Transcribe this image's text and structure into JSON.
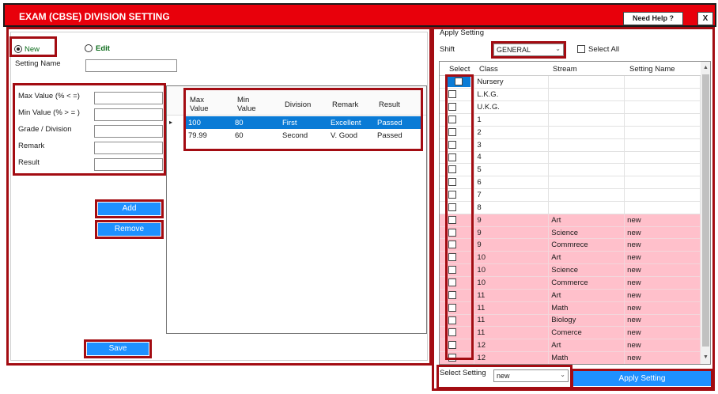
{
  "window": {
    "title": "EXAM (CBSE) DIVISION SETTING",
    "help_label": "Need Help ?",
    "close_label": "X"
  },
  "mode": {
    "new_label": "New",
    "edit_label": "Edit",
    "selected": "new"
  },
  "form": {
    "setting_name_label": "Setting Name",
    "max_value_label": "Max Value  (% < =)",
    "min_value_label": "Min Value   (% > = )",
    "grade_label": "Grade / Division",
    "remark_label": "Remark",
    "result_label": "Result"
  },
  "buttons": {
    "add": "Add",
    "remove": "Remove",
    "save": "Save",
    "apply": "Apply Setting"
  },
  "division_grid": {
    "columns": [
      "Max\nValue",
      "Min\nValue",
      "Division",
      "Remark",
      "Result"
    ],
    "rows": [
      {
        "max": "100",
        "min": "80",
        "division": "First",
        "remark": "Excellent",
        "result": "Passed",
        "selected": true
      },
      {
        "max": "79.99",
        "min": "60",
        "division": "Second",
        "remark": "V. Good",
        "result": "Passed",
        "selected": false
      }
    ]
  },
  "apply": {
    "group_label": "Apply Setting",
    "shift_label": "Shift",
    "shift_value": "GENERAL",
    "select_all_label": "Select All",
    "select_setting_label": "Select Setting",
    "select_setting_value": "new",
    "columns": [
      "Select",
      "Class",
      "Stream",
      "Setting Name"
    ],
    "rows": [
      {
        "class": "Nursery",
        "stream": "",
        "setting": "",
        "pink": false
      },
      {
        "class": "L.K.G.",
        "stream": "",
        "setting": "",
        "pink": false
      },
      {
        "class": "U.K.G.",
        "stream": "",
        "setting": "",
        "pink": false
      },
      {
        "class": "1",
        "stream": "",
        "setting": "",
        "pink": false
      },
      {
        "class": "2",
        "stream": "",
        "setting": "",
        "pink": false
      },
      {
        "class": "3",
        "stream": "",
        "setting": "",
        "pink": false
      },
      {
        "class": "4",
        "stream": "",
        "setting": "",
        "pink": false
      },
      {
        "class": "5",
        "stream": "",
        "setting": "",
        "pink": false
      },
      {
        "class": "6",
        "stream": "",
        "setting": "",
        "pink": false
      },
      {
        "class": "7",
        "stream": "",
        "setting": "",
        "pink": false
      },
      {
        "class": "8",
        "stream": "",
        "setting": "",
        "pink": false
      },
      {
        "class": "9",
        "stream": "Art",
        "setting": "new",
        "pink": true
      },
      {
        "class": "9",
        "stream": "Science",
        "setting": "new",
        "pink": true
      },
      {
        "class": "9",
        "stream": "Commrece",
        "setting": "new",
        "pink": true
      },
      {
        "class": "10",
        "stream": "Art",
        "setting": "new",
        "pink": true
      },
      {
        "class": "10",
        "stream": "Science",
        "setting": "new",
        "pink": true
      },
      {
        "class": "10",
        "stream": "Commerce",
        "setting": "new",
        "pink": true
      },
      {
        "class": "11",
        "stream": "Art",
        "setting": "new",
        "pink": true
      },
      {
        "class": "11",
        "stream": "Math",
        "setting": "new",
        "pink": true
      },
      {
        "class": "11",
        "stream": "Biology",
        "setting": "new",
        "pink": true
      },
      {
        "class": "11",
        "stream": "Comerce",
        "setting": "new",
        "pink": true
      },
      {
        "class": "12",
        "stream": "Art",
        "setting": "new",
        "pink": true
      },
      {
        "class": "12",
        "stream": "Math",
        "setting": "new",
        "pink": true
      }
    ]
  },
  "colors": {
    "title_bar": "#e8000b",
    "highlight": "#a30c12",
    "selection": "#0a7bd6",
    "button": "#1e90ff",
    "pink_row": "#ffc0cb"
  }
}
